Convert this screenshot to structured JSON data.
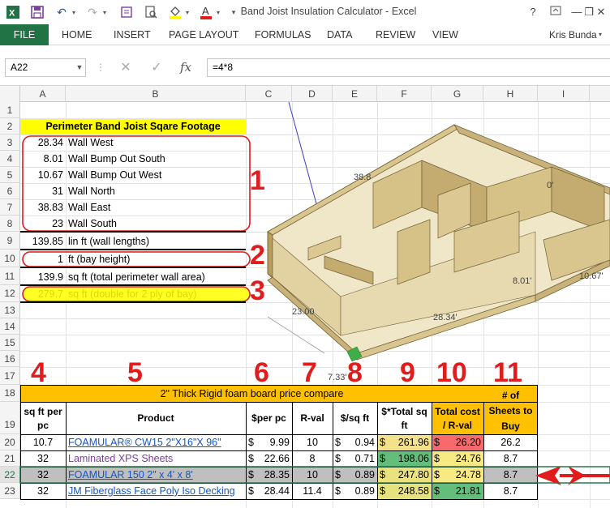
{
  "window": {
    "title": "Band Joist Insulation Calculator - Excel",
    "help": "?",
    "minimize": "—",
    "restore": "❐",
    "close": "✕",
    "user": "Kris Bunda"
  },
  "ribbon": {
    "file": "FILE",
    "tabs": [
      "HOME",
      "INSERT",
      "PAGE LAYOUT",
      "FORMULAS",
      "DATA",
      "REVIEW",
      "VIEW"
    ]
  },
  "formula_bar": {
    "name_box": "A22",
    "formula": "=4*8",
    "fx": "fx",
    "cancel": "✕",
    "enter": "✓"
  },
  "columns": [
    "A",
    "B",
    "C",
    "D",
    "E",
    "F",
    "G",
    "H",
    "I"
  ],
  "rows": [
    "1",
    "2",
    "3",
    "4",
    "5",
    "6",
    "7",
    "8",
    "9",
    "10",
    "11",
    "12",
    "13",
    "14",
    "15",
    "16",
    "17",
    "18",
    "19",
    "20",
    "21",
    "22",
    "23"
  ],
  "perimeter": {
    "header": "Perimeter Band Joist Sqare Footage",
    "walls": [
      {
        "value": "28.34",
        "label": "Wall West"
      },
      {
        "value": "8.01",
        "label": "Wall Bump Out South"
      },
      {
        "value": "10.67",
        "label": "Wall Bump Out West"
      },
      {
        "value": "31",
        "label": "Wall North"
      },
      {
        "value": "38.83",
        "label": "Wall East"
      },
      {
        "value": "23",
        "label": "Wall South"
      }
    ],
    "lin_ft": {
      "value": "139.85",
      "label": "lin ft (wall lengths)"
    },
    "bay_height": {
      "value": "1",
      "label": "ft (bay height)"
    },
    "area": {
      "value": "139.9",
      "label": "sq ft (total perimeter wall area)"
    },
    "double": {
      "value": "279.7",
      "label": "sq ft (double for 2 ply of bay)"
    }
  },
  "annotations": [
    "1",
    "2",
    "3",
    "4",
    "5",
    "6",
    "7",
    "8",
    "9",
    "10",
    "11"
  ],
  "diagram_labels": [
    "38.8",
    "23.00",
    "28.34'",
    "8.01'",
    "10.67'",
    "7.33'",
    "0'"
  ],
  "compare": {
    "title": "2\" Thick Rigid foam board price compare",
    "headers": [
      "sq ft per pc",
      "Product",
      "$per pc",
      "R-val",
      "$/sq ft",
      "$*Total sq ft",
      "Total cost / R-val",
      "# of Sheets to Buy"
    ],
    "rows": [
      {
        "sqft": "10.7",
        "product": "FOAMULAR® CW15 2\"X16\"X 96\"",
        "price_sym": "$",
        "price": "9.99",
        "rval": "10",
        "psf_sym": "$",
        "psf": "0.94",
        "total_sym": "$",
        "total": "261.96",
        "cr_sym": "$",
        "cost_r": "26.20",
        "sheets": "26.2"
      },
      {
        "sqft": "32",
        "product": "Laminated XPS Sheets",
        "price_sym": "$",
        "price": "22.66",
        "rval": "8",
        "psf_sym": "$",
        "psf": "0.71",
        "total_sym": "$",
        "total": "198.06",
        "cr_sym": "$",
        "cost_r": "24.76",
        "sheets": "8.7"
      },
      {
        "sqft": "32",
        "product": "FOAMULAR 150 2\" x 4' x 8'",
        "price_sym": "$",
        "price": "28.35",
        "rval": "10",
        "psf_sym": "$",
        "psf": "0.89",
        "total_sym": "$",
        "total": "247.80",
        "cr_sym": "$",
        "cost_r": "24.78",
        "sheets": "8.7"
      },
      {
        "sqft": "32",
        "product": "JM Fiberglass Face Poly Iso Decking",
        "price_sym": "$",
        "price": "28.44",
        "rval": "11.4",
        "psf_sym": "$",
        "psf": "0.89",
        "total_sym": "$",
        "total": "248.58",
        "cr_sym": "$",
        "cost_r": "21.81",
        "sheets": "8.7"
      }
    ]
  },
  "colors": {
    "excel_green": "#217346",
    "yellow": "#ffff00",
    "orange": "#ffc000",
    "red_annot": "#e01c1c",
    "green_best": "#63be7b",
    "red_worst": "#f8696b",
    "selected_row": "#bfbfbf"
  }
}
